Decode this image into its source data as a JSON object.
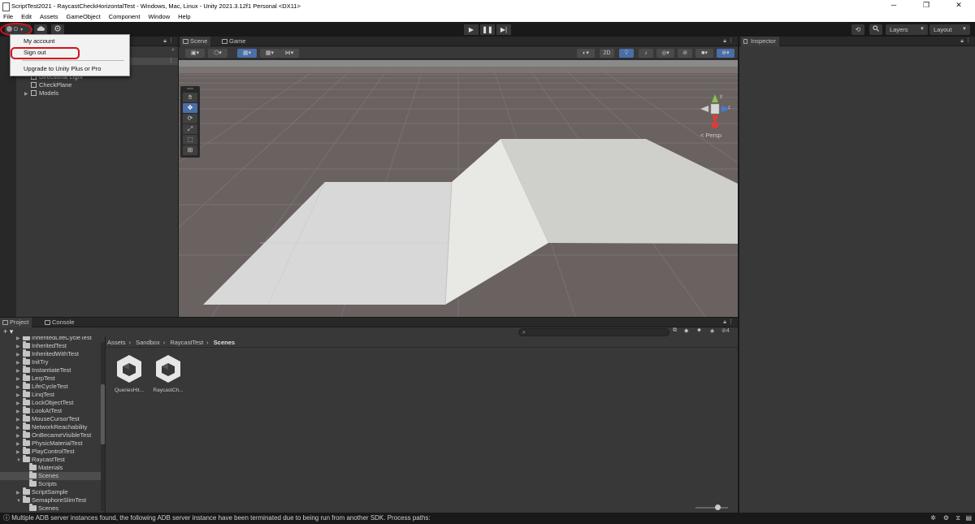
{
  "window": {
    "title": "ScriptTest2021 - RaycastCheckHorizontalTest - Windows, Mac, Linux - Unity 2021.3.12f1 Personal <DX11>",
    "controls": [
      "─",
      "❐",
      "✕"
    ]
  },
  "menu": [
    "File",
    "Edit",
    "Assets",
    "GameObject",
    "Component",
    "Window",
    "Help"
  ],
  "toolbar": {
    "account_initial": "D",
    "layers_label": "Layers",
    "layout_label": "Layout"
  },
  "account_menu": {
    "items": [
      "My account",
      "Sign out",
      "Upgrade to Unity Plus or Pro"
    ],
    "highlight_color": "#d4111b"
  },
  "hierarchy": {
    "items": [
      "Directional Light",
      "CheckPlane",
      "Models"
    ]
  },
  "scene": {
    "tabs": [
      "Scene",
      "Game"
    ],
    "mode_2d": "2D",
    "persp_label": "< Persp",
    "axis_y": "y",
    "axis_z": "z"
  },
  "inspector": {
    "tab": "Inspector"
  },
  "project": {
    "tabs": [
      "Project",
      "Console"
    ],
    "add_label": "+ ▾",
    "tree": [
      {
        "label": "InheritedLifeCycleTest",
        "indent": 1,
        "expand": "▶",
        "open": false
      },
      {
        "label": "InheritedTest",
        "indent": 1,
        "expand": "▶",
        "open": false
      },
      {
        "label": "InheritedWithTest",
        "indent": 1,
        "expand": "▶",
        "open": false
      },
      {
        "label": "InitTry",
        "indent": 1,
        "expand": "▶",
        "open": false
      },
      {
        "label": "InstantiateTest",
        "indent": 1,
        "expand": "▶",
        "open": false
      },
      {
        "label": "LerpTest",
        "indent": 1,
        "expand": "▶",
        "open": false
      },
      {
        "label": "LifeCycleTest",
        "indent": 1,
        "expand": "▶",
        "open": false
      },
      {
        "label": "LinqTest",
        "indent": 1,
        "expand": "▶",
        "open": false
      },
      {
        "label": "LockObjectTest",
        "indent": 1,
        "expand": "▶",
        "open": false
      },
      {
        "label": "LookAtTest",
        "indent": 1,
        "expand": "▶",
        "open": false
      },
      {
        "label": "MouseCursorTest",
        "indent": 1,
        "expand": "▶",
        "open": false
      },
      {
        "label": "NetworkReachability",
        "indent": 1,
        "expand": "▶",
        "open": false
      },
      {
        "label": "OnBecameVisibleTest",
        "indent": 1,
        "expand": "▶",
        "open": false
      },
      {
        "label": "PhysicMaterialTest",
        "indent": 1,
        "expand": "▶",
        "open": false
      },
      {
        "label": "PlayControlTest",
        "indent": 1,
        "expand": "▶",
        "open": false
      },
      {
        "label": "RaycastTest",
        "indent": 1,
        "expand": "▼",
        "open": true
      },
      {
        "label": "Materials",
        "indent": 2,
        "expand": "",
        "open": false
      },
      {
        "label": "Scenes",
        "indent": 2,
        "expand": "",
        "open": false,
        "selected": true
      },
      {
        "label": "Scripts",
        "indent": 2,
        "expand": "",
        "open": false
      },
      {
        "label": "ScriptSample",
        "indent": 1,
        "expand": "▶",
        "open": false
      },
      {
        "label": "SemaphoreSlimTest",
        "indent": 1,
        "expand": "▼",
        "open": true
      },
      {
        "label": "Scenes",
        "indent": 2,
        "expand": "",
        "open": false
      }
    ],
    "breadcrumb": [
      "Assets",
      "Sandbox",
      "RaycastTest",
      "Scenes"
    ],
    "breadcrumb_sep": "›",
    "assets": [
      "QueriesHit...",
      "RaycastCh..."
    ],
    "hidden_count": "4"
  },
  "status": {
    "message": "Multiple ADB server instances found, the following ADB server instance have been terminated due to being run from another SDK. Process paths:"
  }
}
